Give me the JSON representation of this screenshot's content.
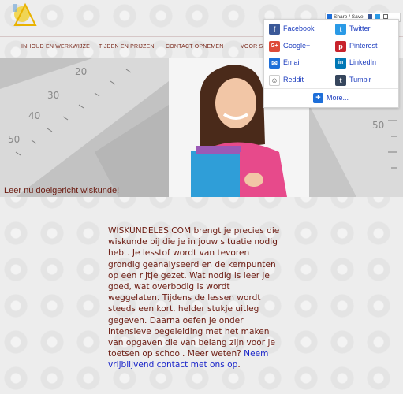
{
  "nav": {
    "items": [
      "INHOUD EN WERKWIJZE",
      "TIJDEN EN PRIJZEN",
      "CONTACT OPNEMEN",
      "VOOR SC"
    ]
  },
  "share_button": {
    "label": "Share / Save"
  },
  "share_panel": {
    "services": [
      {
        "label": "Facebook",
        "icon": "facebook-icon",
        "color": "#3b5998"
      },
      {
        "label": "Twitter",
        "icon": "twitter-icon",
        "color": "#2a9ae6"
      },
      {
        "label": "Google+",
        "icon": "google-plus-icon",
        "color": "#dd4b39"
      },
      {
        "label": "Pinterest",
        "icon": "pinterest-icon",
        "color": "#c8232c"
      },
      {
        "label": "Email",
        "icon": "email-icon",
        "color": "#1e6fd9"
      },
      {
        "label": "LinkedIn",
        "icon": "linkedin-icon",
        "color": "#0077b5"
      },
      {
        "label": "Reddit",
        "icon": "reddit-icon",
        "color": "#ffffff"
      },
      {
        "label": "Tumblr",
        "icon": "tumblr-icon",
        "color": "#36465d"
      }
    ],
    "more_label": "More..."
  },
  "hero": {
    "tagline": "Leer nu doelgericht wiskunde!"
  },
  "main": {
    "text": "WISKUNDELES.COM brengt je precies die wiskunde bij die je in jouw situatie nodig hebt. Je lesstof wordt van tevoren grondig geanalyseerd en de kernpunten op een rijtje gezet. Wat nodig is leer je goed, wat overbodig is wordt weggelaten. Tijdens de lessen wordt steeds een kort, helder stukje uitleg gegeven. Daarna oefen je onder intensieve begeleiding met het maken van opgaven die van belang zijn voor je toetsen op school. Meer weten? ",
    "link": "Neem vrijblijvend contact met ons op",
    "after_link": "."
  }
}
